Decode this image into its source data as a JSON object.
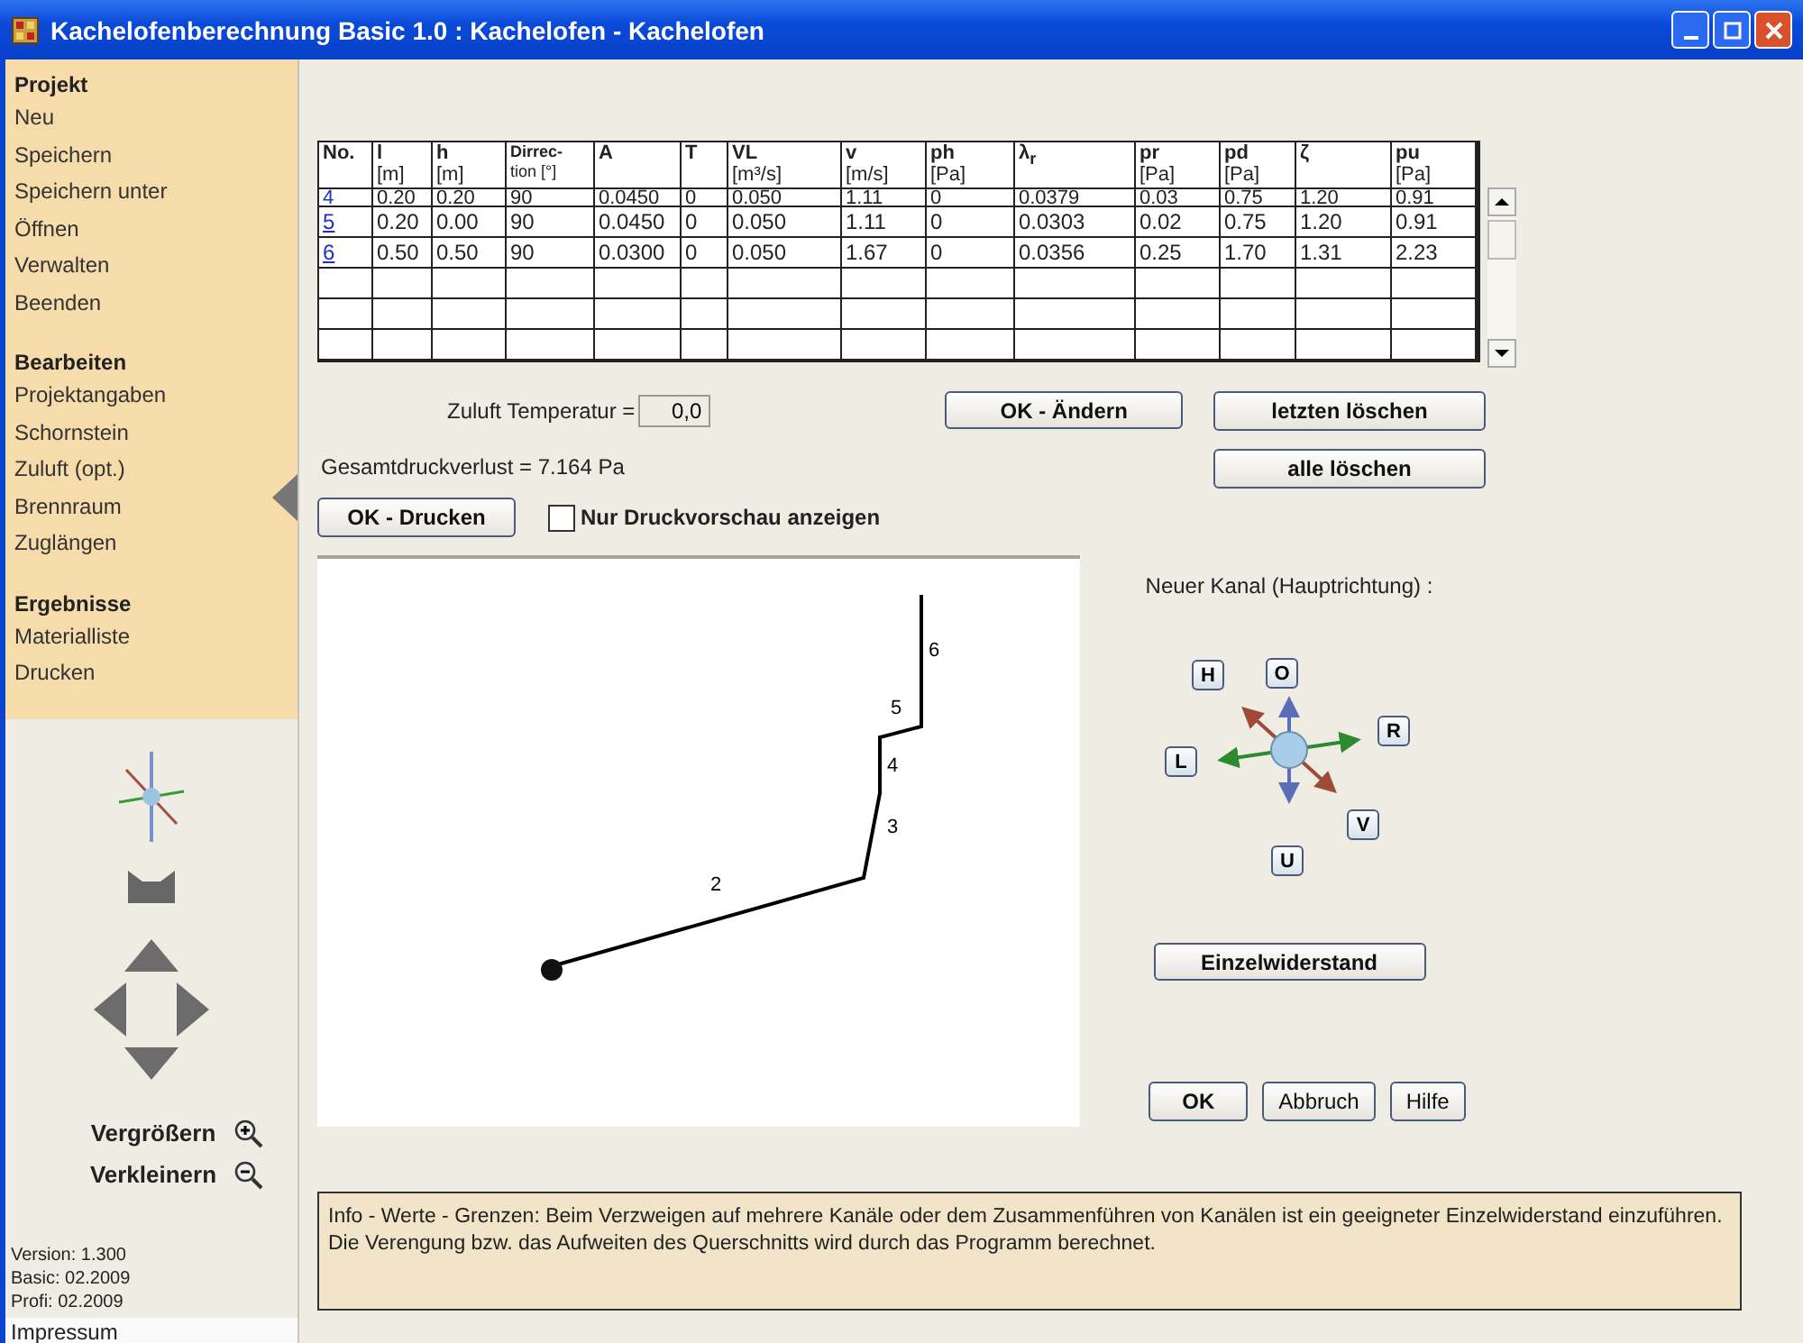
{
  "window": {
    "title": "Kachelofenberechnung Basic 1.0 : Kachelofen - Kachelofen"
  },
  "sidebar": {
    "sections": [
      {
        "heading": "Projekt",
        "items": [
          "Neu",
          "Speichern",
          "Speichern unter",
          "Öffnen",
          "Verwalten",
          "Beenden"
        ]
      },
      {
        "heading": "Bearbeiten",
        "items": [
          "Projektangaben",
          "Schornstein",
          "Zuluft (opt.)",
          "Brennraum",
          "Zuglängen"
        ]
      },
      {
        "heading": "Ergebnisse",
        "items": [
          "Materialliste",
          "Drucken"
        ]
      }
    ],
    "zoom_controls": [
      {
        "label": "Vergrößern",
        "kind": "in"
      },
      {
        "label": "Verkleinern",
        "kind": "out"
      }
    ],
    "version_lines": [
      "Version: 1.300",
      "Basic: 02.2009",
      "Profi: 02.2009"
    ],
    "footer_link": "Impressum"
  },
  "table": {
    "columns": [
      {
        "label": "No.",
        "kind": "plain"
      },
      {
        "label": "l",
        "unit": "[m]",
        "kind": "plain"
      },
      {
        "label": "h",
        "unit": "[m]",
        "kind": "plain"
      },
      {
        "label": "Dirrec-",
        "unit": "tion [°]",
        "kind": "compact"
      },
      {
        "label": "A",
        "kind": "plain"
      },
      {
        "label": "T",
        "kind": "plain"
      },
      {
        "label": "VL",
        "unit": "[m³/s]",
        "kind": "plain"
      },
      {
        "label": "v",
        "unit": "[m/s]",
        "kind": "plain"
      },
      {
        "label": "ph",
        "unit": "[Pa]",
        "kind": "plain"
      },
      {
        "label": "λ$_{r}$",
        "kind": "plain"
      },
      {
        "label": "pr",
        "unit": "[Pa]",
        "kind": "plain"
      },
      {
        "label": "pd",
        "unit": "[Pa]",
        "kind": "plain"
      },
      {
        "label": "ζ",
        "kind": "plain"
      },
      {
        "label": "pu",
        "unit": "[Pa]",
        "kind": "plain"
      }
    ],
    "rows": [
      {
        "cells": [
          "4",
          "0.20",
          "0.20",
          "90",
          "0.0450",
          "0",
          "0.050",
          "1.11",
          "0",
          "0.0379",
          "0.03",
          "0.75",
          "1.20",
          "0.91"
        ]
      },
      {
        "cells": [
          "5",
          "0.20",
          "0.00",
          "90",
          "0.0450",
          "0",
          "0.050",
          "1.11",
          "0",
          "0.0303",
          "0.02",
          "0.75",
          "1.20",
          "0.91"
        ]
      },
      {
        "cells": [
          "6",
          "0.50",
          "0.50",
          "90",
          "0.0300",
          "0",
          "0.050",
          "1.67",
          "0",
          "0.0356",
          "0.25",
          "1.70",
          "1.31",
          "2.23"
        ]
      }
    ]
  },
  "temperature": {
    "label": "Zuluft Temperatur =",
    "value": "0,0"
  },
  "buttons": {
    "change": "OK - Ändern",
    "delete_last": "letzten löschen",
    "delete_all": "alle löschen",
    "print": "OK - Drucken",
    "single_resistance": "Einzelwiderstand",
    "ok": "OK",
    "cancel": "Abbruch",
    "help": "Hilfe"
  },
  "total_loss": "Gesamtdruckverlust = 7.164 Pa",
  "preview_checkbox": {
    "label": "Nur Druckvorschau anzeigen",
    "checked": false
  },
  "diagram": {
    "segments": [
      {
        "label": "6"
      },
      {
        "label": "5"
      },
      {
        "label": "4"
      },
      {
        "label": "3"
      },
      {
        "label": "2"
      }
    ]
  },
  "direction_panel": {
    "title": "Neuer Kanal (Hauptrichtung) :",
    "directions": [
      {
        "label": "O"
      },
      {
        "label": "H"
      },
      {
        "label": "R"
      },
      {
        "label": "L"
      },
      {
        "label": "V"
      },
      {
        "label": "U"
      }
    ]
  },
  "info": "Info - Werte - Grenzen:  Beim Verzweigen auf mehrere Kanäle oder dem Zusammenführen von Kanälen ist ein geeigneter Einzelwiderstand einzuführen. Die Verengung bzw. das Aufweiten des Querschnitts wird durch das Programm berechnet."
}
